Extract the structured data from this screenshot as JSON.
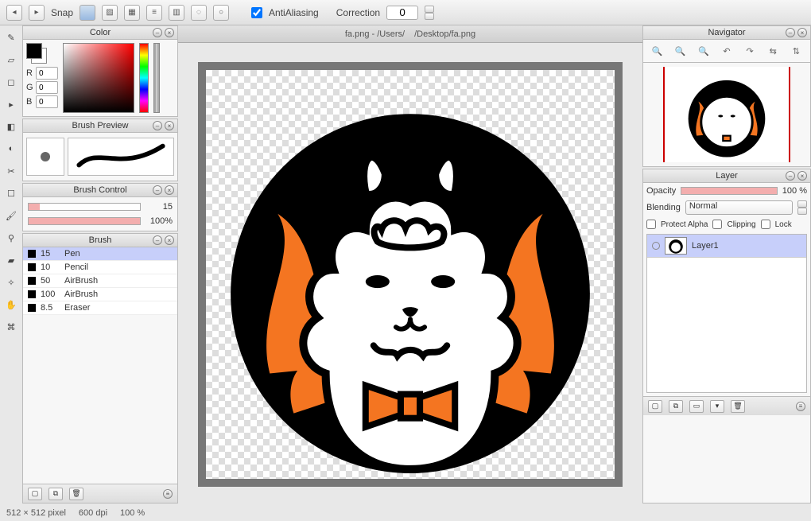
{
  "toolbar": {
    "snap_label": "Snap",
    "antialias_label": "AntiAliasing",
    "antialias_checked": true,
    "correction_label": "Correction",
    "correction_value": "0"
  },
  "tabs": {
    "file_left": "fa.png - /Users/",
    "file_right": "/Desktop/fa.png"
  },
  "panels": {
    "color": {
      "title": "Color",
      "r": "0",
      "g": "0",
      "b": "0"
    },
    "brush_preview": {
      "title": "Brush Preview"
    },
    "brush_control": {
      "title": "Brush Control",
      "size_value": "15",
      "size_percent": 10,
      "opacity_value": "100%",
      "opacity_percent": 100
    },
    "brush": {
      "title": "Brush",
      "items": [
        {
          "size": "15",
          "name": "Pen",
          "selected": true
        },
        {
          "size": "10",
          "name": "Pencil",
          "selected": false
        },
        {
          "size": "50",
          "name": "AirBrush",
          "selected": false
        },
        {
          "size": "100",
          "name": "AirBrush",
          "selected": false
        },
        {
          "size": "8.5",
          "name": "Eraser",
          "selected": false
        }
      ]
    },
    "navigator": {
      "title": "Navigator"
    },
    "layer": {
      "title": "Layer",
      "opacity_label": "Opacity",
      "opacity_value": "100 %",
      "opacity_percent": 100,
      "blending_label": "Blending",
      "blending_value": "Normal",
      "protect_alpha": "Protect Alpha",
      "clipping": "Clipping",
      "lock": "Lock",
      "layers": [
        {
          "name": "Layer1"
        }
      ]
    }
  },
  "status": {
    "dims": "512 × 512 pixel",
    "dpi": "600 dpi",
    "zoom": "100 %"
  }
}
